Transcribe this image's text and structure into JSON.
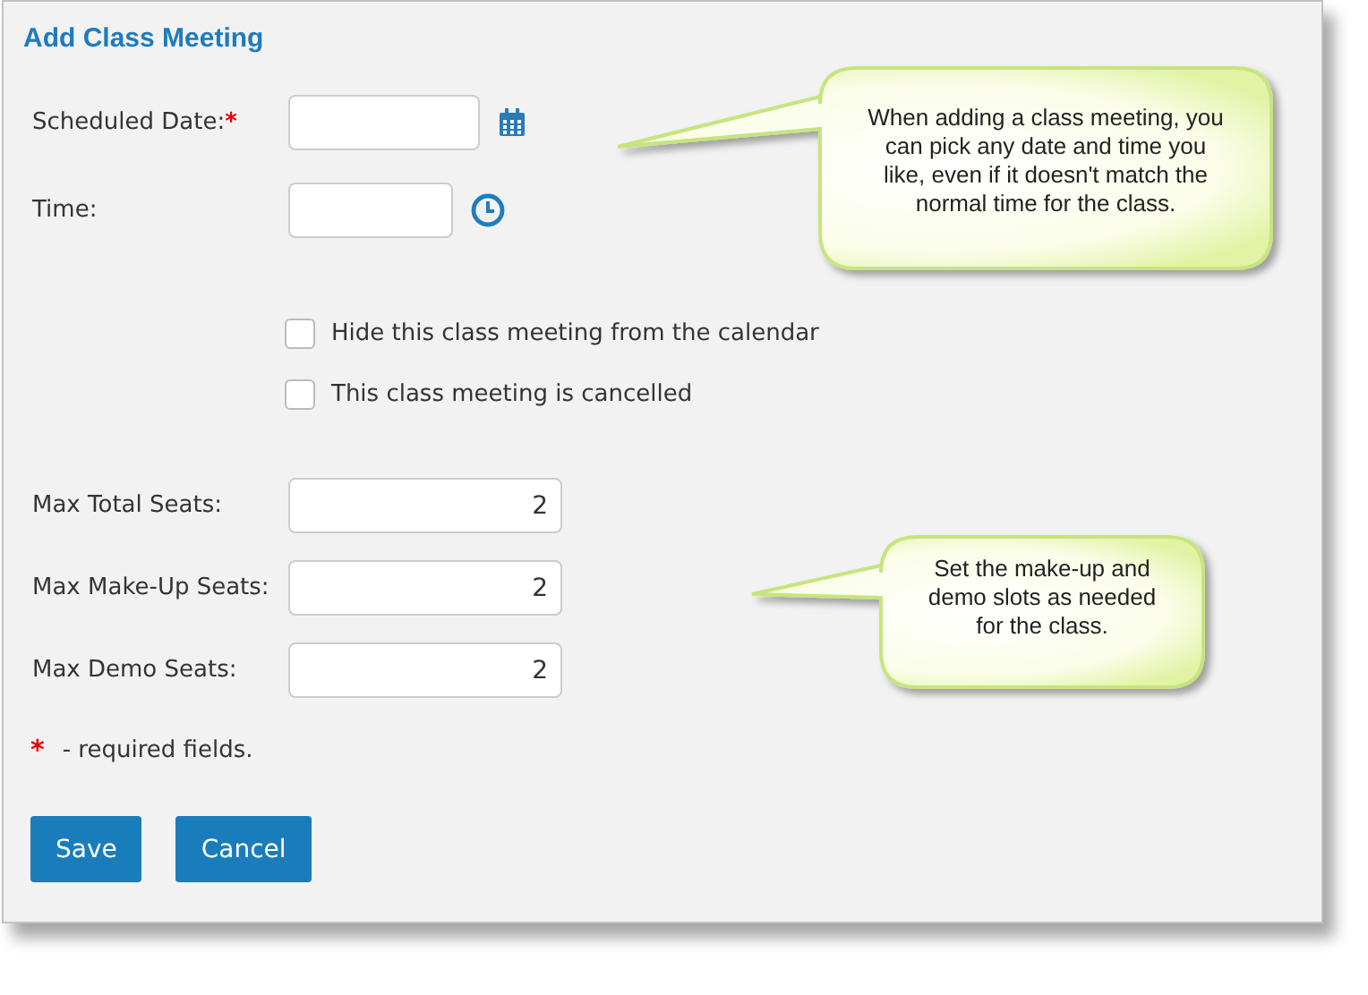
{
  "title": "Add Class Meeting",
  "schedule_fields": [
    {
      "kind": "date",
      "label": "Scheduled Date:",
      "required_mark": "*"
    },
    {
      "kind": "time",
      "label": "Time:"
    }
  ],
  "options": [
    {
      "label": "Hide this class meeting from the calendar",
      "checked": false
    },
    {
      "label": "This class meeting is cancelled",
      "checked": false
    }
  ],
  "seat_fields": [
    {
      "label": "Max Total Seats:",
      "value": "2"
    },
    {
      "label": "Max Make-Up Seats:",
      "value": "2"
    },
    {
      "label": "Max Demo Seats:",
      "value": "2"
    }
  ],
  "required_note": {
    "mark": "*",
    "text": "- required fields."
  },
  "buttons": [
    "Save",
    "Cancel"
  ],
  "callouts": [
    {
      "text": "When adding a class meeting, you can pick any date and time you like, even if it doesn't match the normal time for the class."
    },
    {
      "text": "Set the make-up and demo slots as needed for the class."
    }
  ]
}
